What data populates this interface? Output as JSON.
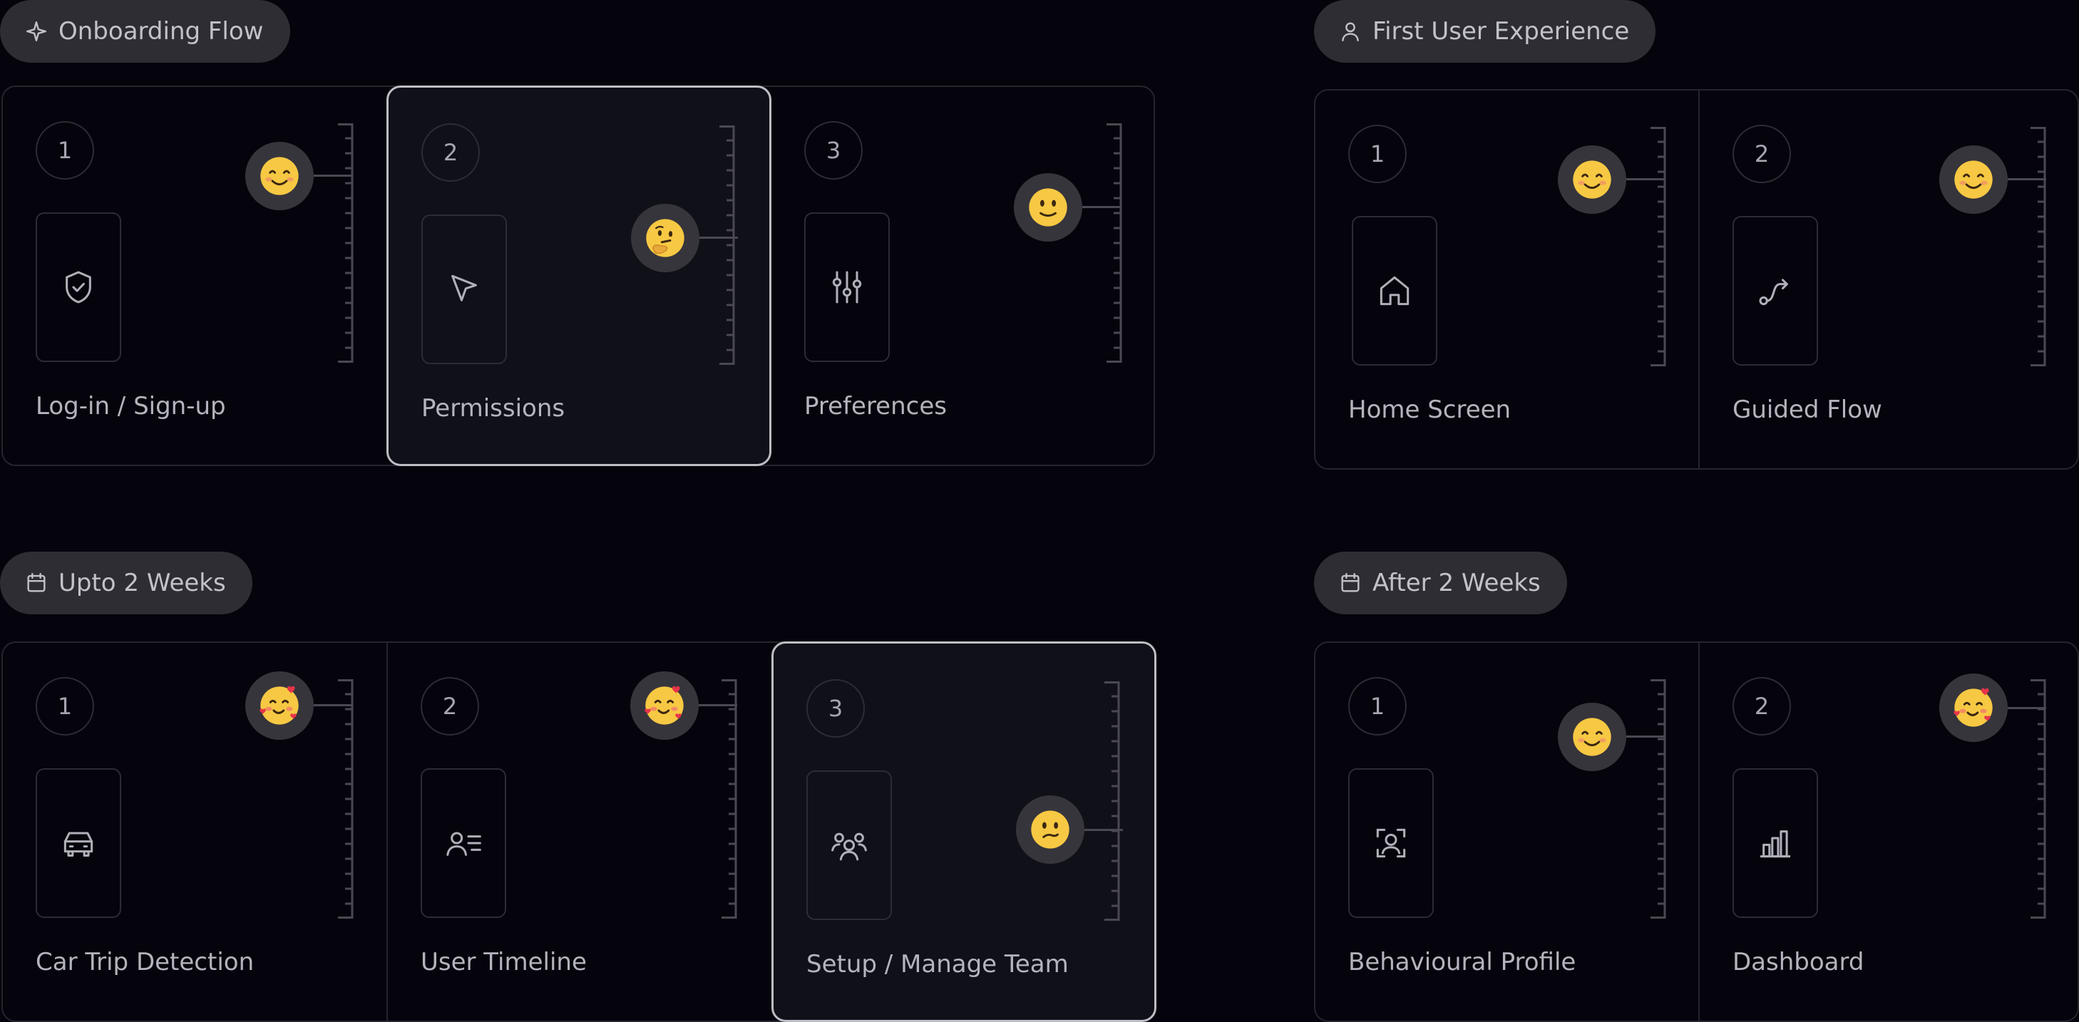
{
  "sections": [
    {
      "id": "onboarding",
      "title": "Onboarding Flow",
      "icon": "sparkle-icon",
      "steps": [
        {
          "number": "1",
          "label": "Log-in / Sign-up",
          "icon": "shield-check-icon",
          "emoji": "smiling-face-icon",
          "satisfaction": 0.78
        },
        {
          "number": "2",
          "label": "Permissions",
          "icon": "cursor-pointer-icon",
          "emoji": "thinking-face-icon",
          "satisfaction": 0.53,
          "selected": true
        },
        {
          "number": "3",
          "label": "Preferences",
          "icon": "sliders-icon",
          "emoji": "slightly-smiling-face-icon",
          "satisfaction": 0.65
        }
      ]
    },
    {
      "id": "first-user",
      "title": "First User Experience",
      "icon": "user-icon",
      "steps": [
        {
          "number": "1",
          "label": "Home Screen",
          "icon": "home-icon",
          "emoji": "smiling-face-icon",
          "satisfaction": 0.78
        },
        {
          "number": "2",
          "label": "Guided Flow",
          "icon": "route-icon",
          "emoji": "smiling-face-icon",
          "satisfaction": 0.78
        }
      ]
    },
    {
      "id": "upto-2-weeks",
      "title": "Upto 2 Weeks",
      "icon": "calendar-icon",
      "steps": [
        {
          "number": "1",
          "label": "Car Trip Detection",
          "icon": "car-icon",
          "emoji": "smiling-face-with-hearts-icon",
          "satisfaction": 0.89
        },
        {
          "number": "2",
          "label": "User Timeline",
          "icon": "user-list-icon",
          "emoji": "smiling-face-with-hearts-icon",
          "satisfaction": 0.89
        },
        {
          "number": "3",
          "label": "Setup / Manage Team",
          "icon": "team-icon",
          "emoji": "confused-face-icon",
          "satisfaction": 0.38,
          "selected": true
        }
      ]
    },
    {
      "id": "after-2-weeks",
      "title": "After 2 Weeks",
      "icon": "calendar-icon",
      "steps": [
        {
          "number": "1",
          "label": "Behavioural Profile",
          "icon": "face-scan-icon",
          "emoji": "smiling-face-icon",
          "satisfaction": 0.76
        },
        {
          "number": "2",
          "label": "Dashboard",
          "icon": "bar-chart-icon",
          "emoji": "smiling-face-with-hearts-icon",
          "satisfaction": 0.88
        }
      ]
    }
  ],
  "colors": {
    "background": "#05040c",
    "card_border": "#26252e",
    "selected_border": "#bdbdc6",
    "pill_background": "#2e2d34",
    "emoji_yellow": "#f7c843"
  }
}
